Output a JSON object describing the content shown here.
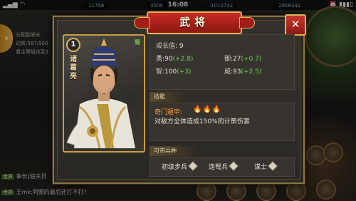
{
  "status_bar": {
    "time": "16:08",
    "left_icons": "signal-wifi-icons",
    "right_icons": "battery-icons"
  },
  "resources": [
    "11756",
    "3500",
    "1010742",
    "2958341"
  ],
  "background": {
    "chat": [
      {
        "tag": "世界",
        "text": "事长]伯夫日"
      },
      {
        "tag": "世界",
        "text": "王mk:同盟的最后还打不打?"
      }
    ],
    "side_text": [
      "分配能够长",
      "动效:587/900",
      "君主等级达到1"
    ]
  },
  "dialog": {
    "title": "武将",
    "close_label": "✕",
    "hero": {
      "level": "1",
      "name": "诸葛亮",
      "faction": "蜀"
    },
    "stats": {
      "growth_label": "成长值:",
      "growth_value": "9",
      "items": [
        {
          "label": "勇:",
          "value": "90",
          "bonus": "(+2.8)"
        },
        {
          "label": "御:",
          "value": "27",
          "bonus": "(+0.7)"
        },
        {
          "label": "智:",
          "value": "100",
          "bonus": "(+3)"
        },
        {
          "label": "威:",
          "value": "93",
          "bonus": "(+2.5)"
        }
      ]
    },
    "skill": {
      "section_label": "技能",
      "name": "奇门遁甲:",
      "flames": "🔥🔥🔥",
      "description": "对敌方全体造成150%的计策伤害"
    },
    "troops": {
      "section_label": "可带兵种",
      "items": [
        "初级步兵",
        "连弩兵",
        "谋士"
      ]
    }
  },
  "colors": {
    "accent_gold": "#c59e47",
    "title_red": "#c92a22",
    "bonus_green": "#64d14a",
    "skill_orange": "#ff9a3c"
  }
}
